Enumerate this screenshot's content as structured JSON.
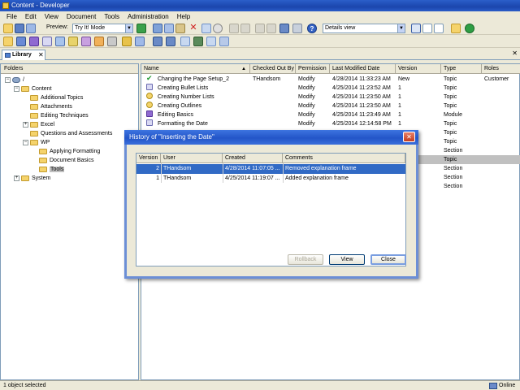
{
  "window": {
    "title": "Content - Developer"
  },
  "menu": [
    "File",
    "Edit",
    "View",
    "Document",
    "Tools",
    "Administration",
    "Help"
  ],
  "toolbar": {
    "preview_label": "Preview:",
    "preview_mode": "Try It! Mode",
    "view_mode": "Details view"
  },
  "library_tab": {
    "label": "Library",
    "close": "✕"
  },
  "panel_close": "✕",
  "folders": {
    "header": "Folders",
    "tree": [
      {
        "label": "/",
        "level": 0,
        "expander": "−",
        "type": "root"
      },
      {
        "label": "Content",
        "level": 1,
        "expander": "−",
        "type": "folder"
      },
      {
        "label": "Additional Topics",
        "level": 2,
        "expander": "",
        "type": "folder"
      },
      {
        "label": "Attachments",
        "level": 2,
        "expander": "",
        "type": "folder"
      },
      {
        "label": "Editing Techniques",
        "level": 2,
        "expander": "",
        "type": "folder"
      },
      {
        "label": "Excel",
        "level": 2,
        "expander": "+",
        "type": "folder"
      },
      {
        "label": "Questions and Assessments",
        "level": 2,
        "expander": "",
        "type": "folder"
      },
      {
        "label": "WP",
        "level": 2,
        "expander": "−",
        "type": "folder"
      },
      {
        "label": "Applying Formatting",
        "level": 3,
        "expander": "",
        "type": "folder"
      },
      {
        "label": "Document Basics",
        "level": 3,
        "expander": "",
        "type": "folder"
      },
      {
        "label": "Tools",
        "level": 3,
        "expander": "",
        "type": "folder",
        "selected": true
      },
      {
        "label": "System",
        "level": 1,
        "expander": "+",
        "type": "folder"
      }
    ]
  },
  "content": {
    "columns": [
      "Name",
      "Checked Out By",
      "Permission",
      "Last Modified Date",
      "Version",
      "Type",
      "Roles"
    ],
    "rows": [
      {
        "name": "Changing the Page Setup_2",
        "checked_out_by": "THandsom",
        "permission": "Modify",
        "modified": "4/28/2014 11:33:23 AM",
        "version": "New",
        "type": "Topic",
        "roles": "Customer",
        "icon": "green"
      },
      {
        "name": "Creating Bullet Lists",
        "checked_out_by": "",
        "permission": "Modify",
        "modified": "4/25/2014 11:23:52 AM",
        "version": "1",
        "type": "Topic",
        "roles": "",
        "icon": "topic"
      },
      {
        "name": "Creating Number Lists",
        "checked_out_by": "",
        "permission": "Modify",
        "modified": "4/25/2014 11:23:50 AM",
        "version": "1",
        "type": "Topic",
        "roles": "",
        "icon": "yellow"
      },
      {
        "name": "Creating Outlines",
        "checked_out_by": "",
        "permission": "Modify",
        "modified": "4/25/2014 11:23:50 AM",
        "version": "1",
        "type": "Topic",
        "roles": "",
        "icon": "yellow"
      },
      {
        "name": "Editing Basics",
        "checked_out_by": "",
        "permission": "Modify",
        "modified": "4/25/2014 11:23:49 AM",
        "version": "1",
        "type": "Module",
        "roles": "",
        "icon": "module"
      },
      {
        "name": "Formatting the Date",
        "checked_out_by": "",
        "permission": "Modify",
        "modified": "4/25/2014 12:14:58 PM",
        "version": "1",
        "type": "Topic",
        "roles": "",
        "icon": "topic"
      },
      {
        "name": "",
        "checked_out_by": "",
        "permission": "",
        "modified": "",
        "version": "",
        "type": "Topic",
        "roles": "",
        "icon": ""
      },
      {
        "name": "",
        "checked_out_by": "",
        "permission": "",
        "modified": "",
        "version": "",
        "type": "Topic",
        "roles": "",
        "icon": ""
      },
      {
        "name": "",
        "checked_out_by": "",
        "permission": "",
        "modified": "",
        "version": "",
        "type": "Section",
        "roles": "",
        "icon": ""
      },
      {
        "name": "",
        "checked_out_by": "",
        "permission": "",
        "modified": "",
        "version": "",
        "type": "Topic",
        "roles": "",
        "icon": "",
        "selected": true
      },
      {
        "name": "",
        "checked_out_by": "",
        "permission": "",
        "modified": "",
        "version": "",
        "type": "Section",
        "roles": "",
        "icon": ""
      },
      {
        "name": "",
        "checked_out_by": "",
        "permission": "",
        "modified": "",
        "version": "",
        "type": "Section",
        "roles": "",
        "icon": ""
      },
      {
        "name": "",
        "checked_out_by": "",
        "permission": "",
        "modified": "",
        "version": "",
        "type": "Section",
        "roles": "",
        "icon": ""
      }
    ]
  },
  "dialog": {
    "title": "History of \"Inserting the Date\"",
    "close": "✕",
    "columns": [
      "Version",
      "User",
      "Created",
      "Comments"
    ],
    "rows": [
      {
        "version": "2",
        "user": "THandsom",
        "created": "4/28/2014 11:07:05 ...",
        "comments": "Removed explanation frame",
        "selected": true
      },
      {
        "version": "1",
        "user": "THandsom",
        "created": "4/25/2014 11:19:07 ...",
        "comments": "Added explanation frame"
      }
    ],
    "buttons": {
      "rollback": "Rollback",
      "view": "View",
      "close": "Close"
    }
  },
  "status": {
    "left": "1 object selected",
    "right": "Online"
  },
  "colors": {
    "title_blue": "#2355c8",
    "selection_blue": "#316ac5",
    "selection_grey": "#c0c0c0"
  }
}
